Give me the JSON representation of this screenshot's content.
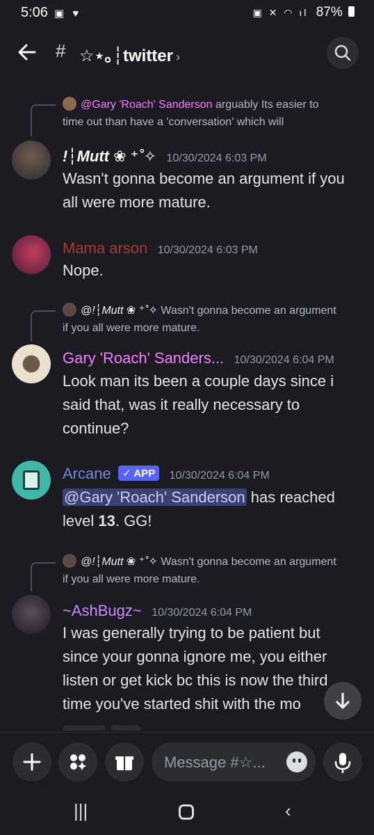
{
  "status_bar": {
    "time": "5:06",
    "battery": "87%"
  },
  "header": {
    "channel_name": "☆⋆｡┆twitter",
    "channel_hash": "#"
  },
  "messages": [
    {
      "reply_name": "@Gary 'Roach' Sanderson",
      "reply_text_1": "arguably Its easier to",
      "reply_text_2": "time out than have a 'conversation' which will",
      "author": "!┆Mutt ❀ ⁺˚✧",
      "timestamp": "10/30/2024 6:03 PM",
      "text": "Wasn't gonna become an argument if you all were more mature."
    },
    {
      "author": "Mama arson",
      "timestamp": "10/30/2024 6:03 PM",
      "text": "Nope."
    },
    {
      "reply_name": "@!┆Mutt ❀ ⁺˚✧",
      "reply_text_1": "Wasn't gonna become an argument",
      "reply_text_2": "if you all were more mature.",
      "author": "Gary 'Roach' Sanders...",
      "timestamp": "10/30/2024 6:04 PM",
      "text": "Look man its been a couple days since i said that, was it really necessary to continue?"
    },
    {
      "author": "Arcane",
      "badge": "✓ APP",
      "timestamp": "10/30/2024 6:04 PM",
      "mention": "@Gary 'Roach' Sanderson",
      "text_a": " has reached level ",
      "level": "13",
      "text_b": ". GG!"
    },
    {
      "reply_name": "@!┆Mutt ❀ ⁺˚✧",
      "reply_text_1": "Wasn't gonna become an argument",
      "reply_text_2": "if you all were more mature.",
      "author": "~AshBugz~",
      "timestamp": "10/30/2024 6:04 PM",
      "text": "I was generally trying to be patient but since your gonna ignore me, you either listen or get kick bc this is now the third time you've started shit with the mo"
    }
  ],
  "composer": {
    "placeholder": "Message #☆..."
  },
  "colors": {
    "background": "#1b1b21",
    "mutt": "#ffffff",
    "mama_arson": "#a8392f",
    "gary": "#f47fff",
    "arcane": "#7289da",
    "ashbugz": "#c98cff",
    "app_badge": "#5865f2"
  },
  "icons": {
    "back": "arrow-left-icon",
    "search": "search-icon",
    "plus": "plus-icon",
    "apps": "apps-icon",
    "gift": "gift-icon",
    "emoji": "emoji-icon",
    "mic": "microphone-icon",
    "scroll": "arrow-down-icon"
  }
}
